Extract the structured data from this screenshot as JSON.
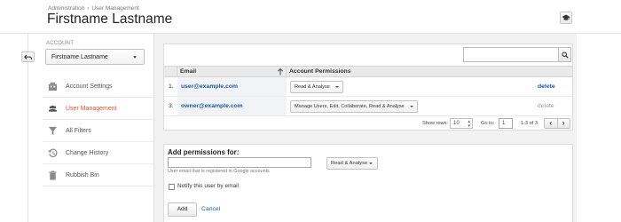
{
  "header": {
    "breadcrumb": [
      "Administration",
      "User Management"
    ],
    "breadcrumb_separator": "›",
    "title": "Firstname Lastname",
    "help_icon": "graduation-cap-icon"
  },
  "sidebar": {
    "account_label": "ACCOUNT",
    "account_selected": "Firstname Lastname",
    "items": [
      {
        "label": "Account Settings",
        "icon": "building-icon",
        "active": false
      },
      {
        "label": "User Management",
        "icon": "users-icon",
        "active": true
      },
      {
        "label": "All Filters",
        "icon": "filter-icon",
        "active": false
      },
      {
        "label": "Change History",
        "icon": "history-icon",
        "active": false
      },
      {
        "label": "Rubbish Bin",
        "icon": "trash-icon",
        "active": false
      }
    ]
  },
  "users_table": {
    "search_placeholder": "",
    "columns": [
      "Email",
      "Account Permissions"
    ],
    "rows": [
      {
        "num": "1.",
        "email": "user@example.com",
        "permission": "Read & Analyse",
        "action": "delete",
        "action_enabled": true
      },
      {
        "num": "3.",
        "email": "owner@example.com",
        "permission": "Manage Users, Edit, Collaborate, Read & Analyse",
        "action": "delete",
        "action_enabled": false
      }
    ],
    "pager": {
      "show_rows_label": "Show rows:",
      "show_rows_value": "10",
      "goto_label": "Go to:",
      "goto_value": "1",
      "range": "1-3 of 3",
      "prev": "‹",
      "next": "›"
    }
  },
  "add_permissions": {
    "title": "Add permissions for:",
    "email_value": "",
    "email_hint": "User email that is registered in Google accounts",
    "permission": "Read & Analyse",
    "notify_label": "Notify this user by email",
    "notify_checked": false,
    "add_label": "Add",
    "cancel_label": "Cancel"
  },
  "colors": {
    "accent_orange": "#e8512f",
    "link_blue": "#1c5ba8"
  }
}
